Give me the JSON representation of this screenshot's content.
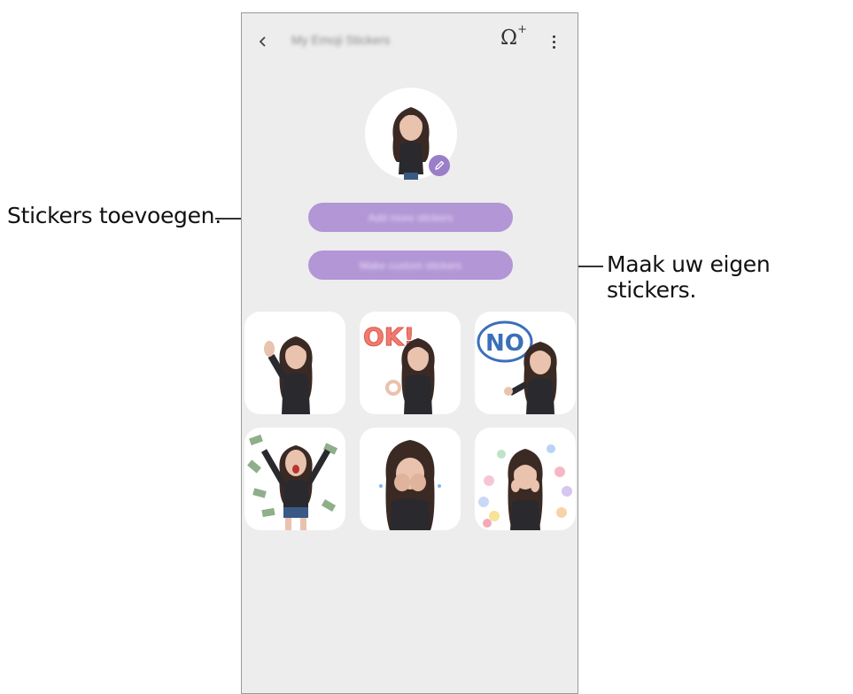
{
  "callouts": {
    "left": "Stickers toevoegen.",
    "right": "Maak uw eigen stickers."
  },
  "app": {
    "title": "My Emoji Stickers",
    "back_icon": "chevron-left-icon",
    "add_icon": "omega-plus-icon",
    "more_icon": "more-vertical-icon"
  },
  "buttons": {
    "add_stickers": "Add more stickers",
    "make_custom": "Make custom stickers"
  },
  "stickers": [
    {
      "name": "wave"
    },
    {
      "name": "ok",
      "text": "OK!"
    },
    {
      "name": "no",
      "text": "NO"
    },
    {
      "name": "money-rain"
    },
    {
      "name": "crying"
    },
    {
      "name": "hearts"
    }
  ],
  "colors": {
    "accent": "#b296d6",
    "background": "#ededed"
  }
}
